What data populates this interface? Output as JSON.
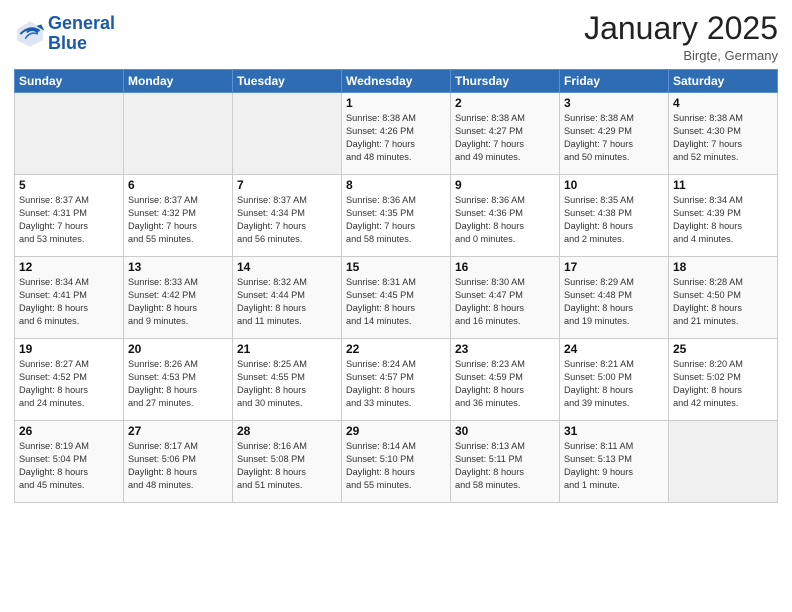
{
  "logo": {
    "line1": "General",
    "line2": "Blue"
  },
  "title": "January 2025",
  "location": "Birgte, Germany",
  "days_header": [
    "Sunday",
    "Monday",
    "Tuesday",
    "Wednesday",
    "Thursday",
    "Friday",
    "Saturday"
  ],
  "weeks": [
    [
      {
        "day": "",
        "info": ""
      },
      {
        "day": "",
        "info": ""
      },
      {
        "day": "",
        "info": ""
      },
      {
        "day": "1",
        "info": "Sunrise: 8:38 AM\nSunset: 4:26 PM\nDaylight: 7 hours\nand 48 minutes."
      },
      {
        "day": "2",
        "info": "Sunrise: 8:38 AM\nSunset: 4:27 PM\nDaylight: 7 hours\nand 49 minutes."
      },
      {
        "day": "3",
        "info": "Sunrise: 8:38 AM\nSunset: 4:29 PM\nDaylight: 7 hours\nand 50 minutes."
      },
      {
        "day": "4",
        "info": "Sunrise: 8:38 AM\nSunset: 4:30 PM\nDaylight: 7 hours\nand 52 minutes."
      }
    ],
    [
      {
        "day": "5",
        "info": "Sunrise: 8:37 AM\nSunset: 4:31 PM\nDaylight: 7 hours\nand 53 minutes."
      },
      {
        "day": "6",
        "info": "Sunrise: 8:37 AM\nSunset: 4:32 PM\nDaylight: 7 hours\nand 55 minutes."
      },
      {
        "day": "7",
        "info": "Sunrise: 8:37 AM\nSunset: 4:34 PM\nDaylight: 7 hours\nand 56 minutes."
      },
      {
        "day": "8",
        "info": "Sunrise: 8:36 AM\nSunset: 4:35 PM\nDaylight: 7 hours\nand 58 minutes."
      },
      {
        "day": "9",
        "info": "Sunrise: 8:36 AM\nSunset: 4:36 PM\nDaylight: 8 hours\nand 0 minutes."
      },
      {
        "day": "10",
        "info": "Sunrise: 8:35 AM\nSunset: 4:38 PM\nDaylight: 8 hours\nand 2 minutes."
      },
      {
        "day": "11",
        "info": "Sunrise: 8:34 AM\nSunset: 4:39 PM\nDaylight: 8 hours\nand 4 minutes."
      }
    ],
    [
      {
        "day": "12",
        "info": "Sunrise: 8:34 AM\nSunset: 4:41 PM\nDaylight: 8 hours\nand 6 minutes."
      },
      {
        "day": "13",
        "info": "Sunrise: 8:33 AM\nSunset: 4:42 PM\nDaylight: 8 hours\nand 9 minutes."
      },
      {
        "day": "14",
        "info": "Sunrise: 8:32 AM\nSunset: 4:44 PM\nDaylight: 8 hours\nand 11 minutes."
      },
      {
        "day": "15",
        "info": "Sunrise: 8:31 AM\nSunset: 4:45 PM\nDaylight: 8 hours\nand 14 minutes."
      },
      {
        "day": "16",
        "info": "Sunrise: 8:30 AM\nSunset: 4:47 PM\nDaylight: 8 hours\nand 16 minutes."
      },
      {
        "day": "17",
        "info": "Sunrise: 8:29 AM\nSunset: 4:48 PM\nDaylight: 8 hours\nand 19 minutes."
      },
      {
        "day": "18",
        "info": "Sunrise: 8:28 AM\nSunset: 4:50 PM\nDaylight: 8 hours\nand 21 minutes."
      }
    ],
    [
      {
        "day": "19",
        "info": "Sunrise: 8:27 AM\nSunset: 4:52 PM\nDaylight: 8 hours\nand 24 minutes."
      },
      {
        "day": "20",
        "info": "Sunrise: 8:26 AM\nSunset: 4:53 PM\nDaylight: 8 hours\nand 27 minutes."
      },
      {
        "day": "21",
        "info": "Sunrise: 8:25 AM\nSunset: 4:55 PM\nDaylight: 8 hours\nand 30 minutes."
      },
      {
        "day": "22",
        "info": "Sunrise: 8:24 AM\nSunset: 4:57 PM\nDaylight: 8 hours\nand 33 minutes."
      },
      {
        "day": "23",
        "info": "Sunrise: 8:23 AM\nSunset: 4:59 PM\nDaylight: 8 hours\nand 36 minutes."
      },
      {
        "day": "24",
        "info": "Sunrise: 8:21 AM\nSunset: 5:00 PM\nDaylight: 8 hours\nand 39 minutes."
      },
      {
        "day": "25",
        "info": "Sunrise: 8:20 AM\nSunset: 5:02 PM\nDaylight: 8 hours\nand 42 minutes."
      }
    ],
    [
      {
        "day": "26",
        "info": "Sunrise: 8:19 AM\nSunset: 5:04 PM\nDaylight: 8 hours\nand 45 minutes."
      },
      {
        "day": "27",
        "info": "Sunrise: 8:17 AM\nSunset: 5:06 PM\nDaylight: 8 hours\nand 48 minutes."
      },
      {
        "day": "28",
        "info": "Sunrise: 8:16 AM\nSunset: 5:08 PM\nDaylight: 8 hours\nand 51 minutes."
      },
      {
        "day": "29",
        "info": "Sunrise: 8:14 AM\nSunset: 5:10 PM\nDaylight: 8 hours\nand 55 minutes."
      },
      {
        "day": "30",
        "info": "Sunrise: 8:13 AM\nSunset: 5:11 PM\nDaylight: 8 hours\nand 58 minutes."
      },
      {
        "day": "31",
        "info": "Sunrise: 8:11 AM\nSunset: 5:13 PM\nDaylight: 9 hours\nand 1 minute."
      },
      {
        "day": "",
        "info": ""
      }
    ]
  ]
}
